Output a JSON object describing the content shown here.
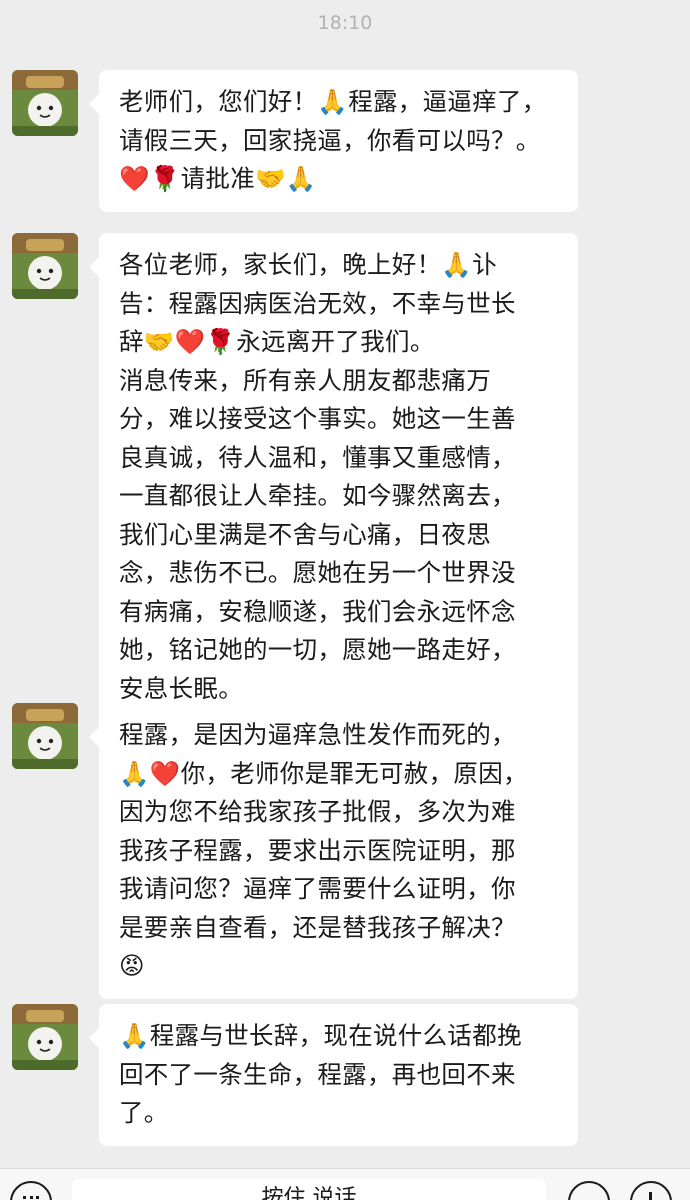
{
  "status": {
    "time": "18:10"
  },
  "messages": [
    {
      "sender": "avatar",
      "text": "老师们，您们好！🙏程露，逼逼痒了，\n请假三天，回家挠逼，你看可以吗？。\n❤️🌹请批准🤝🙏"
    },
    {
      "sender": "avatar",
      "text": "各位老师，家长们，晚上好！🙏讣\n告：程露因病医治无效，不幸与世长\n辞🤝❤️🌹永远离开了我们。\n消息传来，所有亲人朋友都悲痛万\n分，难以接受这个事实。她这一生善\n良真诚，待人温和，懂事又重感情，\n一直都很让人牵挂。如今骤然离去，\n我们心里满是不舍与心痛，日夜思\n念，悲伤不已。愿她在另一个世界没\n有病痛，安稳顺遂，我们会永远怀念\n她，铭记她的一切，愿她一路走好，\n安息长眠。"
    },
    {
      "sender": "avatar",
      "text": "程露，是因为逼痒急性发作而死的，\n🙏❤️你，老师你是罪无可赦，原因，\n因为您不给我家孩子批假，多次为难\n我孩子程露，要求出示医院证明，那\n我请问您？逼痒了需要什么证明，你\n是要亲自查看，还是替我孩子解决？\n😡"
    },
    {
      "sender": "avatar",
      "text": "🙏程露与世长辞，现在说什么话都挽\n回不了一条生命，程露，再也回不来\n了。"
    }
  ],
  "input_bar": {
    "placeholder": "按住 说话",
    "icons": [
      "voice-icon",
      "emoji-icon",
      "plus-icon"
    ]
  },
  "colors": {
    "background": "#ededed",
    "bubble": "#ffffff",
    "time_text": "#b2b2b2"
  }
}
